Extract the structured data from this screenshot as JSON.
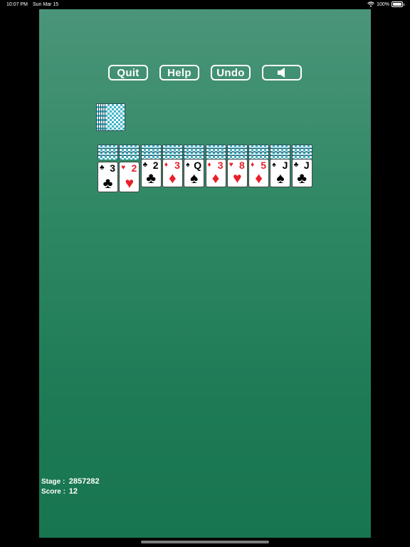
{
  "status_bar": {
    "time": "10:07 PM",
    "date": "Sun Mar 15",
    "battery": "100%"
  },
  "toolbar": {
    "quit_label": "Quit",
    "help_label": "Help",
    "undo_label": "Undo",
    "sound_icon": "speaker-icon"
  },
  "colors": {
    "table_top": "#4b957a",
    "table_bottom": "#17754f",
    "card_back": "#3fb5c8",
    "red_suit": "#e8202a",
    "black_suit": "#000000"
  },
  "stock": {
    "visible_back_cards": 5
  },
  "tableau": [
    {
      "face_down": 4,
      "rank": "3",
      "suit": "♣",
      "color": "black"
    },
    {
      "face_down": 4,
      "rank": "2",
      "suit": "♥",
      "color": "red"
    },
    {
      "face_down": 4,
      "rank": "2",
      "suit": "♣",
      "color": "black"
    },
    {
      "face_down": 4,
      "rank": "3",
      "suit": "♦",
      "color": "red"
    },
    {
      "face_down": 4,
      "rank": "Q",
      "suit": "♠",
      "color": "black"
    },
    {
      "face_down": 4,
      "rank": "3",
      "suit": "♦",
      "color": "red"
    },
    {
      "face_down": 4,
      "rank": "8",
      "suit": "♥",
      "color": "red"
    },
    {
      "face_down": 4,
      "rank": "5",
      "suit": "♦",
      "color": "red"
    },
    {
      "face_down": 4,
      "rank": "J",
      "suit": "♠",
      "color": "black"
    },
    {
      "face_down": 4,
      "rank": "J",
      "suit": "♣",
      "color": "black"
    }
  ],
  "info": {
    "stage_label": "Stage :",
    "stage_value": "2857282",
    "score_label": "Score :",
    "score_value": "12"
  }
}
